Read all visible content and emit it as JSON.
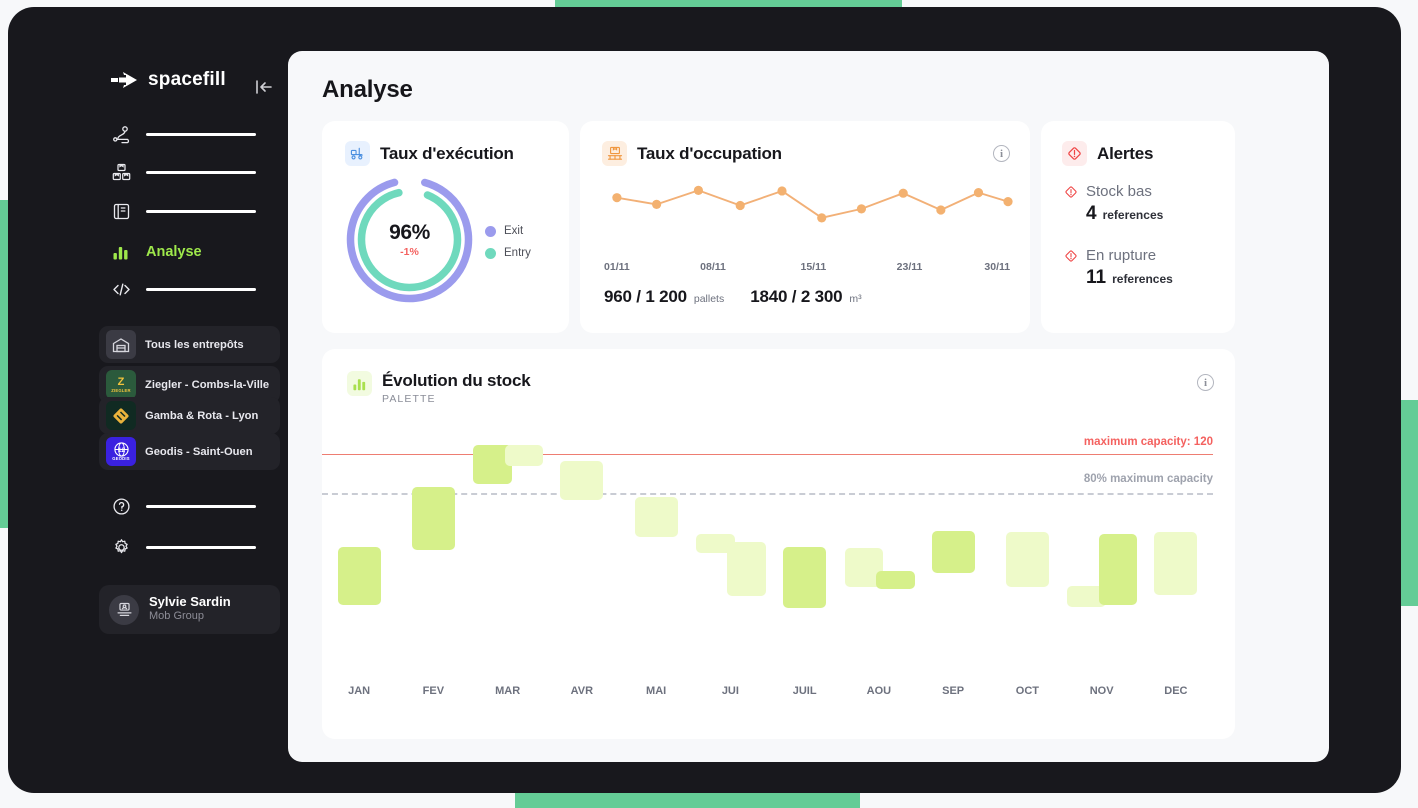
{
  "sidebar": {
    "logo_text": "spacefill",
    "collapse_icon": "collapse-left-icon",
    "nav": [
      {
        "icon": "route-icon",
        "label": "",
        "redacted": true,
        "active": false
      },
      {
        "icon": "boxes-icon",
        "label": "",
        "redacted": true,
        "active": false
      },
      {
        "icon": "book-icon",
        "label": "",
        "redacted": true,
        "active": false
      },
      {
        "icon": "bar-chart-icon",
        "label": "Analyse",
        "redacted": false,
        "active": true
      },
      {
        "icon": "code-icon",
        "label": "",
        "redacted": true,
        "active": false
      }
    ],
    "warehouses": [
      {
        "name": "Tous les entrepôts",
        "logo_text": "",
        "logo_bg": "#3b3b44",
        "logo_fg": "#d6d6dd",
        "selected": true
      },
      {
        "name": "Ziegler - Combs-la-Ville",
        "logo_text": "ZIEGLER",
        "logo_bg": "#2b5a3c",
        "logo_fg": "#f2c33d",
        "selected": false
      },
      {
        "name": "Gamba & Rota - Lyon",
        "logo_text": "",
        "logo_bg": "#102a22",
        "logo_fg": "#eab33c",
        "selected": false
      },
      {
        "name": "Geodis - Saint-Ouen",
        "logo_text": "GEODIS",
        "logo_bg": "#3a21e0",
        "logo_fg": "#ffffff",
        "selected": false
      }
    ],
    "mini_nav": [
      {
        "icon": "help-circle-icon",
        "label": "",
        "redacted": true
      },
      {
        "icon": "gear-icon",
        "label": "",
        "redacted": true
      }
    ],
    "user": {
      "name": "Sylvie Sardin",
      "org": "Mob Group",
      "avatar_icon": "user-desk-icon"
    }
  },
  "header": {
    "title": "Analyse"
  },
  "execution_card": {
    "icon": "forklift-icon",
    "icon_bg": "#e8f1fe",
    "icon_fg": "#4a8fe0",
    "title": "Taux d'exécution",
    "percent": "96%",
    "delta": "-1%",
    "delta_color": "#f4615f",
    "legend": [
      {
        "label": "Exit",
        "color": "#9b9bed"
      },
      {
        "label": "Entry",
        "color": "#6fd9bd"
      }
    ]
  },
  "occupation_card": {
    "icon": "pallet-icon",
    "icon_bg": "#fdeee0",
    "icon_fg": "#f0973f",
    "title": "Taux d'occupation",
    "info_icon": "info-icon",
    "stats": [
      {
        "value": "960 / 1 200",
        "unit": "pallets"
      },
      {
        "value": "1840 / 2 300",
        "unit": "m³"
      }
    ]
  },
  "alerts_card": {
    "icon": "alert-diamond-icon",
    "icon_bg": "#fdecec",
    "icon_fg": "#ef4444",
    "title": "Alertes",
    "rows": [
      {
        "icon": "alert-diamond-icon",
        "label": "Stock bas",
        "count": "4",
        "unit": "references"
      },
      {
        "icon": "alert-diamond-icon",
        "label": "En rupture",
        "count": "11",
        "unit": "references"
      }
    ]
  },
  "stock_card": {
    "icon": "bar-chart-icon",
    "icon_bg": "#f2fbe0",
    "icon_fg": "#a9e04e",
    "title": "Évolution du stock",
    "subtitle": "PALETTE",
    "info_icon": "info-icon"
  },
  "chart_data": [
    {
      "type": "line",
      "name": "occupation-sparkline",
      "title": "Taux d'occupation",
      "x": [
        "01/11",
        "",
        "",
        "08/11",
        "",
        "",
        "15/11",
        "",
        "",
        "23/11",
        "",
        "30/11"
      ],
      "tick_labels": [
        "01/11",
        "08/11",
        "15/11",
        "23/11",
        "30/11"
      ],
      "tick_positions_pct": [
        5,
        28,
        52,
        75,
        96
      ],
      "values": [
        0.72,
        0.6,
        0.85,
        0.58,
        0.84,
        0.36,
        0.52,
        0.8,
        0.5,
        0.81,
        0.65
      ],
      "point_positions_pct": [
        5,
        14.5,
        24.5,
        34.5,
        44.5,
        54,
        63.5,
        73.5,
        82.5,
        91.5,
        99
      ],
      "color": "#f2b077",
      "marker_color": "#f3b170",
      "grid": false,
      "legend": "none",
      "xlabel": "",
      "ylabel": ""
    },
    {
      "type": "bar",
      "name": "stock-evolution-floating-bars",
      "title": "Évolution du stock",
      "subtitle": "PALETTE",
      "ylabel": "pallets",
      "xlabel": "",
      "categories": [
        "JAN",
        "FEV",
        "MAR",
        "AVR",
        "MAI",
        "JUI",
        "JUIL",
        "AOU",
        "SEP",
        "OCT",
        "NOV",
        "DEC"
      ],
      "reference_lines": [
        {
          "label": "maximum capacity: 120",
          "value": 120,
          "color": "#f4615f",
          "style": "solid"
        },
        {
          "label": "80% maximum capacity",
          "value": 96,
          "color": "#c9ccd4",
          "style": "dashed"
        }
      ],
      "ylim": [
        0,
        132
      ],
      "bars": [
        {
          "category": "JAN",
          "sub": 0,
          "low": 27,
          "high": 63,
          "shade": "dark"
        },
        {
          "category": "FEV",
          "sub": 0,
          "low": 61,
          "high": 100,
          "shade": "dark"
        },
        {
          "category": "MAR",
          "sub": 0,
          "low": 102,
          "high": 126,
          "shade": "dark"
        },
        {
          "category": "MAR",
          "sub": 1,
          "low": 113,
          "high": 126,
          "shade": "light"
        },
        {
          "category": "AVR",
          "sub": 0,
          "low": 92,
          "high": 116,
          "shade": "light"
        },
        {
          "category": "MAI",
          "sub": 0,
          "low": 69,
          "high": 94,
          "shade": "light"
        },
        {
          "category": "JUI",
          "sub": 0,
          "low": 59,
          "high": 71,
          "shade": "light"
        },
        {
          "category": "JUI",
          "sub": 1,
          "low": 33,
          "high": 66,
          "shade": "light"
        },
        {
          "category": "JUIL",
          "sub": 0,
          "low": 25,
          "high": 63,
          "shade": "dark"
        },
        {
          "category": "AOU",
          "sub": 0,
          "low": 38,
          "high": 62,
          "shade": "light"
        },
        {
          "category": "AOU",
          "sub": 1,
          "low": 37,
          "high": 48,
          "shade": "dark"
        },
        {
          "category": "SEP",
          "sub": 0,
          "low": 47,
          "high": 73,
          "shade": "dark"
        },
        {
          "category": "OCT",
          "sub": 0,
          "low": 38,
          "high": 72,
          "shade": "light"
        },
        {
          "category": "NOV",
          "sub": 0,
          "low": 26,
          "high": 39,
          "shade": "light"
        },
        {
          "category": "NOV",
          "sub": 1,
          "low": 27,
          "high": 71,
          "shade": "dark"
        },
        {
          "category": "DEC",
          "sub": 0,
          "low": 33,
          "high": 72,
          "shade": "light"
        }
      ],
      "colors": {
        "dark": "#d6f08a",
        "light": "#eefac9"
      },
      "grid": false,
      "legend": "none"
    }
  ]
}
